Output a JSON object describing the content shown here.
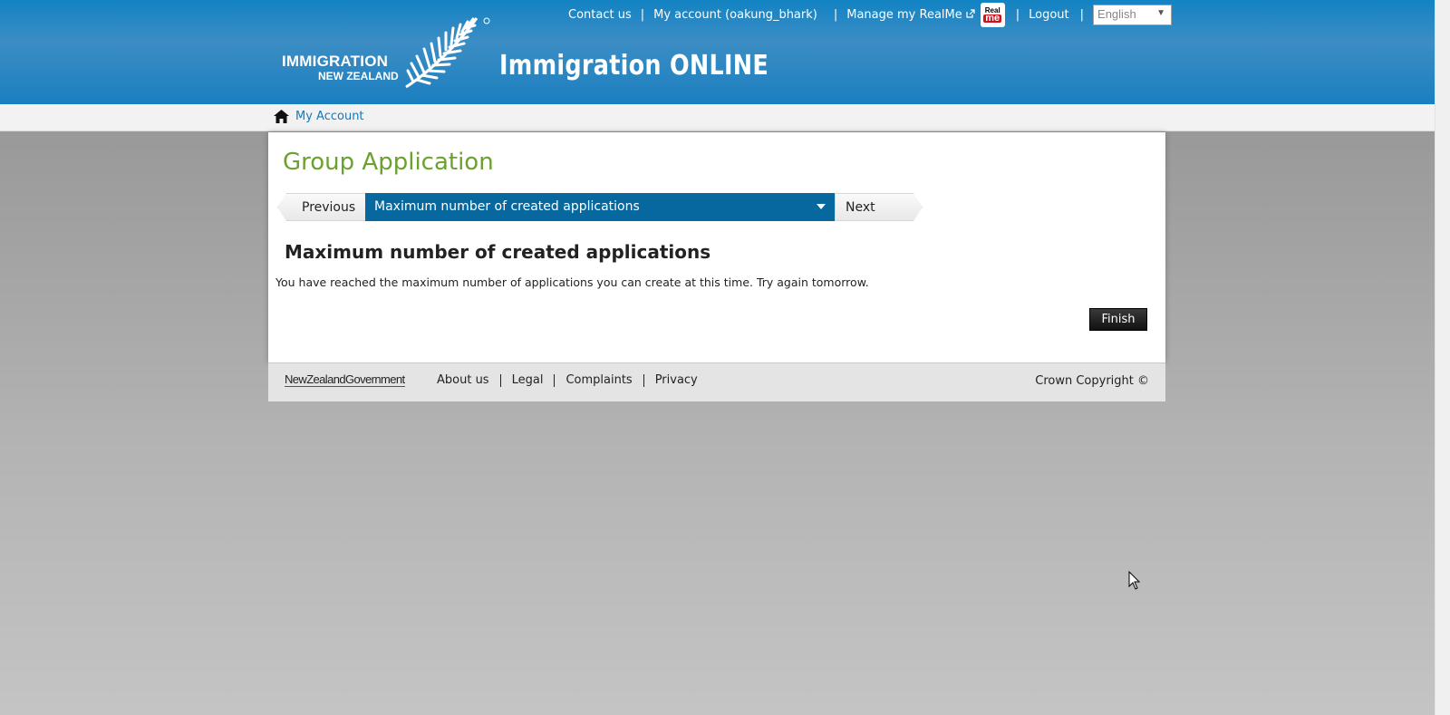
{
  "header": {
    "links": {
      "contact": "Contact us",
      "my_account": "My account (oakung_bhark)",
      "realme": "Manage my RealMe",
      "logout": "Logout",
      "separator": "|"
    },
    "realme_badge": {
      "top": "Real",
      "bottom": "me"
    },
    "language": "English",
    "logo_line1": "IMMIGRATION",
    "logo_line2": "NEW ZEALAND",
    "site_title": "Immigration ONLINE"
  },
  "breadcrumb": {
    "label": "My Account"
  },
  "main": {
    "page_title": "Group Application",
    "nav": {
      "previous": "Previous",
      "current_step": "Maximum number of created applications",
      "next": "Next"
    },
    "section_title": "Maximum number of created applications",
    "message": "You have reached the maximum number of applications you can create at this time. Try again tomorrow.",
    "finish": "Finish"
  },
  "footer": {
    "gov_logo": "NewZealandGovernment",
    "links": [
      "About us",
      "Legal",
      "Complaints",
      "Privacy"
    ],
    "copyright": "Crown Copyright ©"
  },
  "colors": {
    "header_blue": "#1a7fbf",
    "step_blue": "#07689f",
    "title_green": "#6aa12f",
    "link_blue": "#1479b8"
  },
  "icons": [
    "external-link-icon",
    "fern-icon",
    "home-icon",
    "caret-down-icon",
    "mouse-cursor-icon"
  ]
}
